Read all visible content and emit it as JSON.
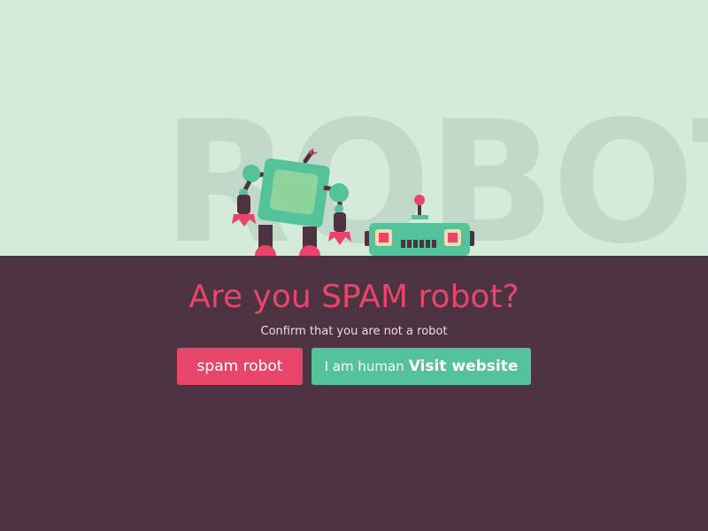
{
  "hero": {
    "background_word": "ROBOT",
    "colors": {
      "sky": "#d4ebda",
      "floor": "#4d3341",
      "accent_red": "#e7466a",
      "accent_green": "#54c29a"
    }
  },
  "headline": "Are you SPAM robot?",
  "subtitle": "Confirm that you are not a robot",
  "buttons": {
    "spam_label": "spam robot",
    "human_label": "I am human",
    "human_link": "Visit website"
  }
}
